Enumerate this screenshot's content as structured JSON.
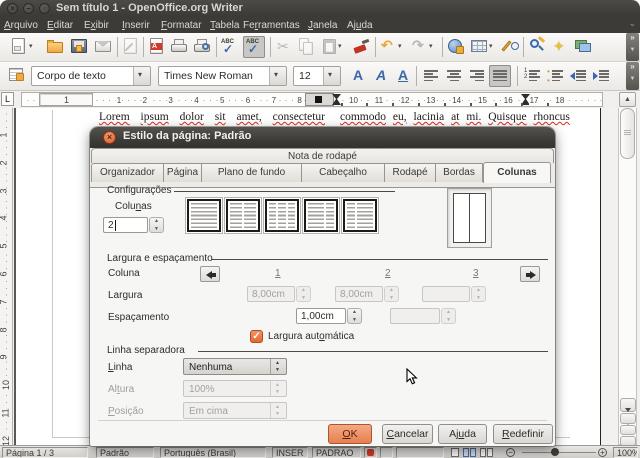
{
  "window": {
    "title": "Sem título 1 - OpenOffice.org Writer"
  },
  "menubar": {
    "items": [
      {
        "t": "Arquivo",
        "a": 0
      },
      {
        "t": "Editar",
        "a": 0
      },
      {
        "t": "Exibir",
        "a": 1
      },
      {
        "t": "Inserir",
        "a": 0
      },
      {
        "t": "Formatar",
        "a": 0
      },
      {
        "t": "Tabela",
        "a": 0
      },
      {
        "t": "Ferramentas",
        "a": 2
      },
      {
        "t": "Janela",
        "a": 0
      },
      {
        "t": "Ajuda",
        "a": 2
      }
    ]
  },
  "toolbar1": {
    "icons": [
      "new-document",
      "open",
      "save",
      "email",
      "edit-file",
      "export-pdf",
      "print",
      "page-preview",
      "spelling",
      "auto-spellcheck",
      "cut",
      "copy",
      "paste",
      "format-paintbrush",
      "undo",
      "redo",
      "hyperlink",
      "table",
      "draw-functions",
      "find-replace",
      "navigator",
      "gallery"
    ]
  },
  "toolbar2": {
    "style_combo": "Corpo de texto",
    "font_combo": "Times New Roman",
    "size_combo": "12",
    "bold": "A",
    "italic": "A",
    "underline": "A",
    "icons": [
      "styles",
      "bold",
      "italic",
      "underline",
      "align-left",
      "align-center",
      "align-right",
      "justify",
      "numbered-list",
      "bullet-list",
      "decrease-indent",
      "increase-indent"
    ]
  },
  "ruler": {
    "corner": "L",
    "margin_label": "1",
    "h_numbers": [
      "1",
      "2",
      "3",
      "4",
      "5",
      "6",
      "7",
      "8",
      "9",
      "10",
      "11",
      "12",
      "13",
      "14",
      "15",
      "16",
      "17",
      "18"
    ],
    "v_numbers": [
      "1",
      "2",
      "3",
      "4",
      "5",
      "6",
      "7",
      "8",
      "9",
      "10",
      "11",
      "12"
    ]
  },
  "document": {
    "col1_words": [
      "Lorem",
      "ipsum",
      "dolor",
      "sit",
      "amet,",
      "consectetur"
    ],
    "col2_words": [
      "commodo",
      "eu,",
      "lacinia",
      "at",
      "mi.",
      "Quisque",
      "rhoncus"
    ]
  },
  "dialog": {
    "title": "Estilo da página: Padrão",
    "close": "×",
    "tab_row1": "Nota de rodapé",
    "tabs": [
      "Organizador",
      "Página",
      "Plano de fundo",
      "Cabeçalho",
      "Rodapé",
      "Bordas",
      "Colunas"
    ],
    "active_tab": "Colunas",
    "configuracoes": {
      "label": "Configurações",
      "colunas_label": {
        "t": "Colunas",
        "a": 4
      },
      "colunas_value": "2",
      "presets": [
        "one-column",
        "two-columns",
        "three-columns",
        "left-wide",
        "right-wide"
      ]
    },
    "largura": {
      "label": "Largura e espaçamento",
      "coluna_label": "Coluna",
      "col_numbers": [
        "1",
        "2",
        "3"
      ],
      "largura_label": "Largura",
      "largura_values": [
        "8,00cm",
        "8,00cm",
        ""
      ],
      "espacamento_label": "Espaçamento",
      "espacamento_values": [
        "1,00cm",
        ""
      ],
      "auto_label": {
        "t": "Largura automática",
        "a": 11
      },
      "auto_checked": "✓"
    },
    "linha": {
      "label": "Linha separadora",
      "linha_label": {
        "t": "Linha",
        "a": 0
      },
      "linha_value": "Nenhuma",
      "altura_label": {
        "t": "Altura",
        "a": 2
      },
      "altura_value": "100%",
      "posicao_label": {
        "t": "Posição",
        "a": 0
      },
      "posicao_value": "Em cima"
    },
    "buttons": {
      "ok": {
        "t": "OK",
        "a": 0
      },
      "cancelar": {
        "t": "Cancelar",
        "a": 0
      },
      "ajuda": {
        "t": "Ajuda",
        "a": 2
      },
      "redefinir": {
        "t": "Redefinir",
        "a": 0
      }
    }
  },
  "statusbar": {
    "page": "Página 1 / 3",
    "style": "Padrão",
    "language": "Português (Brasil)",
    "insert_mode": "INSER",
    "selection_mode": "PADRAO",
    "zoom": "100%"
  }
}
